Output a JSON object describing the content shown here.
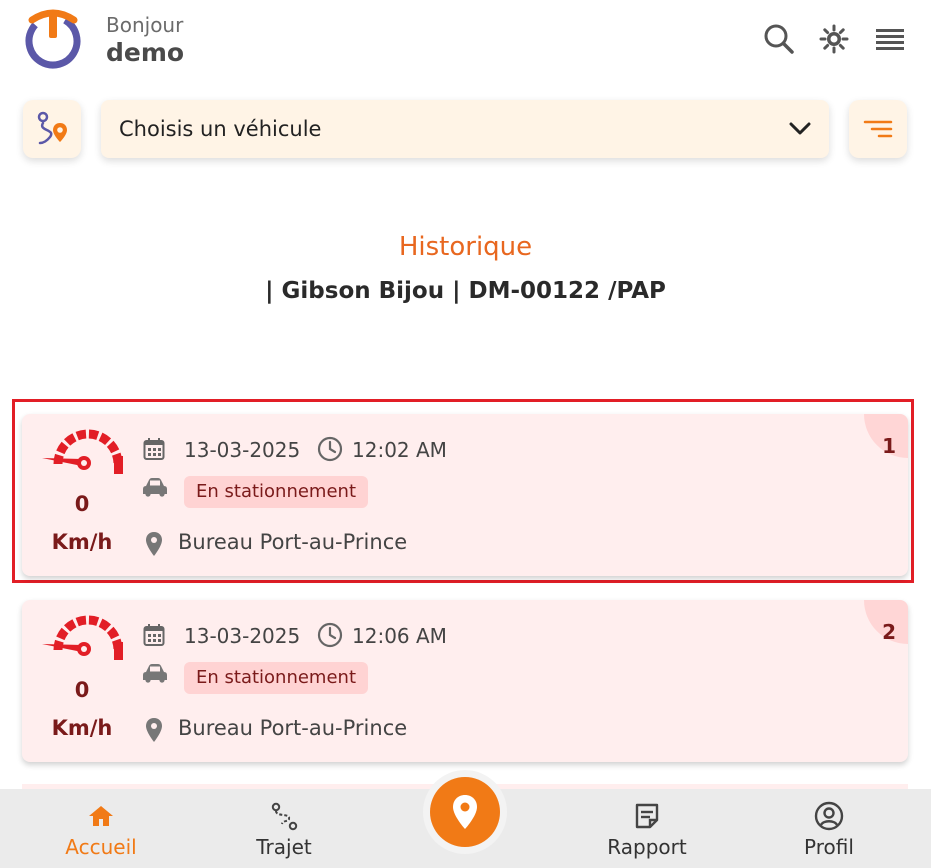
{
  "header": {
    "greeting": "Bonjour",
    "username": "demo",
    "icons": [
      "search-icon",
      "sun-icon",
      "menu-icon"
    ]
  },
  "selector": {
    "route_icon": "route-pin-icon",
    "placeholder": "Choisis un véhicule",
    "filter_icon": "filter-icon"
  },
  "history": {
    "title": "Historique",
    "subtitle": "| Gibson Bijou | DM-00122 /PAP"
  },
  "records": [
    {
      "number": "1",
      "speed": "0",
      "unit": "Km/h",
      "date": "13-03-2025",
      "time": "12:02 AM",
      "status": "En stationnement",
      "location": "Bureau Port-au-Prince",
      "highlighted": true
    },
    {
      "number": "2",
      "speed": "0",
      "unit": "Km/h",
      "date": "13-03-2025",
      "time": "12:06 AM",
      "status": "En stationnement",
      "location": "Bureau Port-au-Prince",
      "highlighted": false
    }
  ],
  "nav": {
    "items": [
      {
        "label": "Accueil",
        "icon": "home-icon",
        "active": true
      },
      {
        "label": "Trajet",
        "icon": "route-icon",
        "active": false
      },
      {
        "label": "Rapport",
        "icon": "report-icon",
        "active": false
      },
      {
        "label": "Profil",
        "icon": "profile-icon",
        "active": false
      }
    ],
    "center_icon": "location-pin-icon"
  },
  "colors": {
    "accent": "#f17a16",
    "title": "#e8671f",
    "card_bg": "#ffeeee",
    "badge_bg": "#ffd3d3",
    "highlight_border": "#e21e26",
    "gauge_red": "#e21e26"
  }
}
